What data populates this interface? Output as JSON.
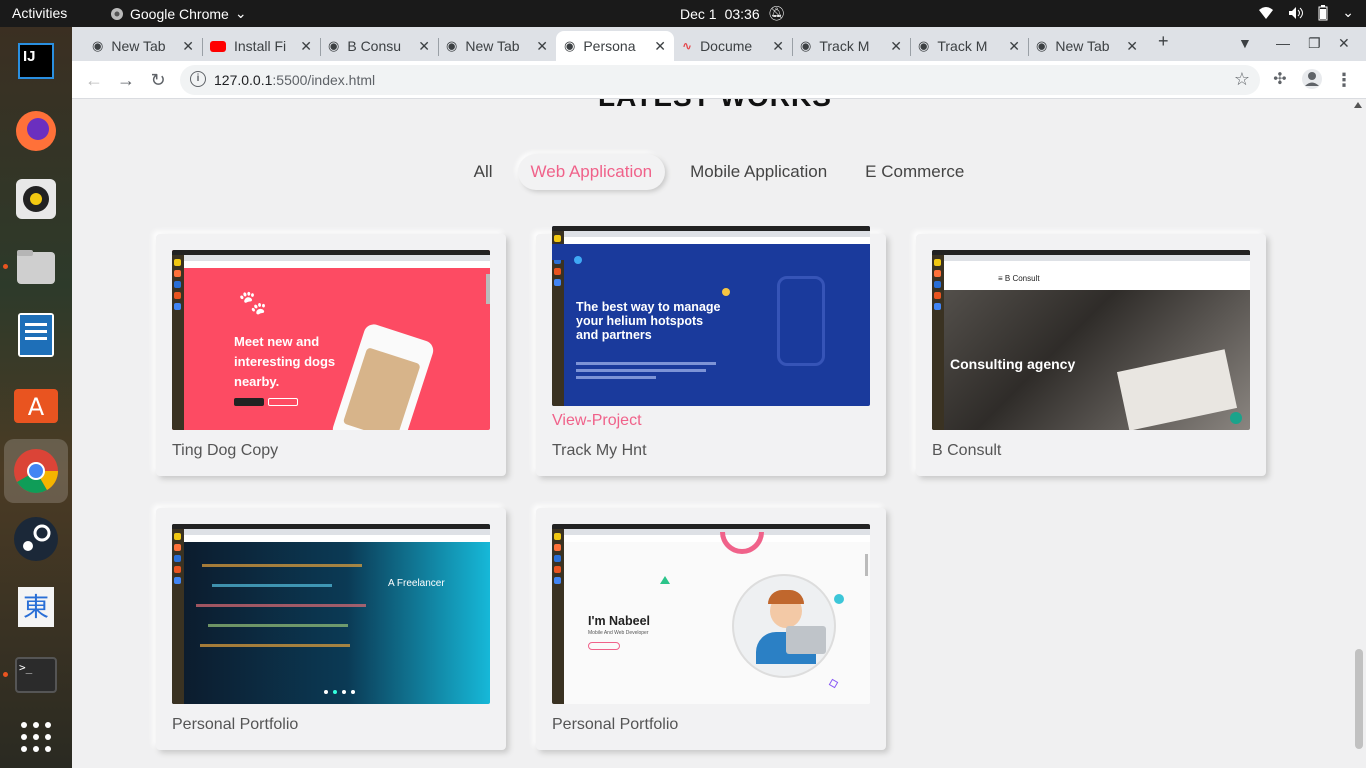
{
  "topbar": {
    "activities": "Activities",
    "app_name": "Google Chrome",
    "date": "Dec 1",
    "time": "03:36"
  },
  "dock": {
    "items": [
      "intellij-icon",
      "firefox-icon",
      "rhythmbox-icon",
      "files-icon",
      "libreoffice-writer-icon",
      "software-center-icon",
      "chrome-icon",
      "steam-icon",
      "input-method-icon",
      "terminal-icon",
      "app-grid-icon"
    ]
  },
  "browser": {
    "tabs": [
      {
        "label": "New Tab",
        "icon": "chrome-globe-icon"
      },
      {
        "label": "Install Fi",
        "icon": "youtube-icon"
      },
      {
        "label": "B Consu",
        "icon": "globe-icon"
      },
      {
        "label": "New Tab",
        "icon": "chrome-globe-icon"
      },
      {
        "label": "Persona",
        "icon": "globe-icon",
        "active": true
      },
      {
        "label": "Docume",
        "icon": "docs-icon"
      },
      {
        "label": "Track M",
        "icon": "globe-icon"
      },
      {
        "label": "Track M",
        "icon": "globe-icon"
      },
      {
        "label": "New Tab",
        "icon": "chrome-globe-icon"
      }
    ],
    "url_host": "127.0.0.1",
    "url_rest": ":5500/index.html"
  },
  "page": {
    "heading": "LATEST WORKS",
    "filters": [
      "All",
      "Web Application",
      "Mobile Application",
      "E Commerce"
    ],
    "active_filter": "Web Application",
    "projects": [
      {
        "title": "Ting Dog Copy",
        "thumb_text": "Meet new and interesting dogs nearby."
      },
      {
        "title": "Track My Hnt",
        "link": "View-Project",
        "thumb_text": "The best way to manage your helium hotspots and partners"
      },
      {
        "title": "B Consult",
        "thumb_text": "Consulting agency"
      },
      {
        "title": "Personal Portfolio",
        "thumb_text": "A Freelancer"
      },
      {
        "title": "Personal Portfolio",
        "thumb_text": "I'm Nabeel",
        "thumb_sub": "Mobile And Web Developer"
      }
    ]
  },
  "colors": {
    "accent_pink": "#f0628a",
    "page_bg": "#f0f0f1",
    "tinder_red": "#fd4b63",
    "helium_blue": "#1a3a9c"
  }
}
